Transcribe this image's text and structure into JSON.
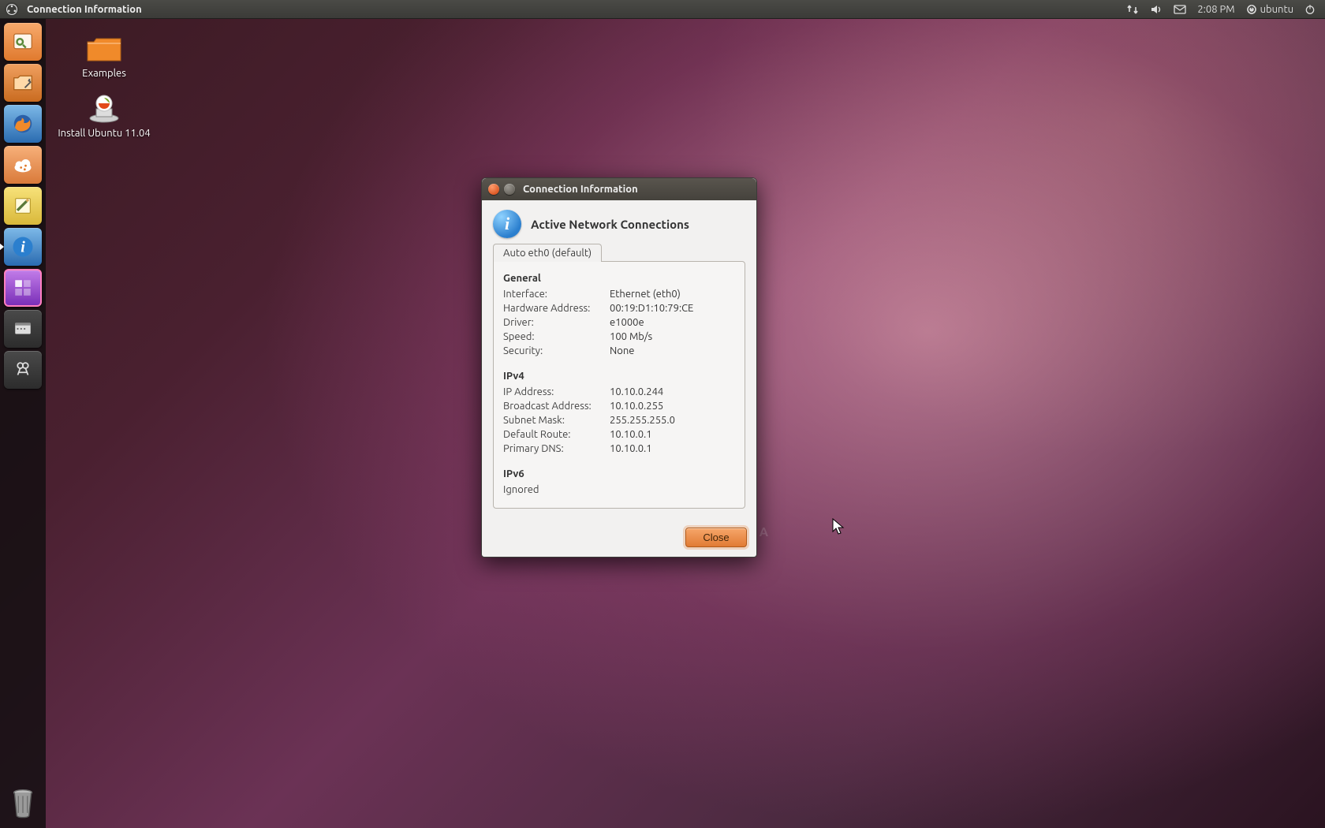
{
  "panel": {
    "app_title": "Connection Information",
    "time": "2:08 PM",
    "session_user": "ubuntu"
  },
  "desktop": {
    "icons": [
      {
        "label": "Examples"
      },
      {
        "label": "Install Ubuntu 11.04"
      }
    ]
  },
  "dialog": {
    "window_title": "Connection Information",
    "heading": "Active Network Connections",
    "tab_label": "Auto eth0 (default)",
    "sections": {
      "general": {
        "title": "General",
        "rows": [
          {
            "k": "Interface:",
            "v": "Ethernet (eth0)"
          },
          {
            "k": "Hardware Address:",
            "v": "00:19:D1:10:79:CE"
          },
          {
            "k": "Driver:",
            "v": "e1000e"
          },
          {
            "k": "Speed:",
            "v": "100 Mb/s"
          },
          {
            "k": "Security:",
            "v": "None"
          }
        ]
      },
      "ipv4": {
        "title": "IPv4",
        "rows": [
          {
            "k": "IP Address:",
            "v": "10.10.0.244"
          },
          {
            "k": "Broadcast Address:",
            "v": "10.10.0.255"
          },
          {
            "k": "Subnet Mask:",
            "v": "255.255.255.0"
          },
          {
            "k": "Default Route:",
            "v": "10.10.0.1"
          },
          {
            "k": "Primary DNS:",
            "v": "10.10.0.1"
          }
        ]
      },
      "ipv6": {
        "title": "IPv6",
        "status": "Ignored"
      }
    },
    "close_label": "Close"
  },
  "watermark": "SOFTPEDIA"
}
